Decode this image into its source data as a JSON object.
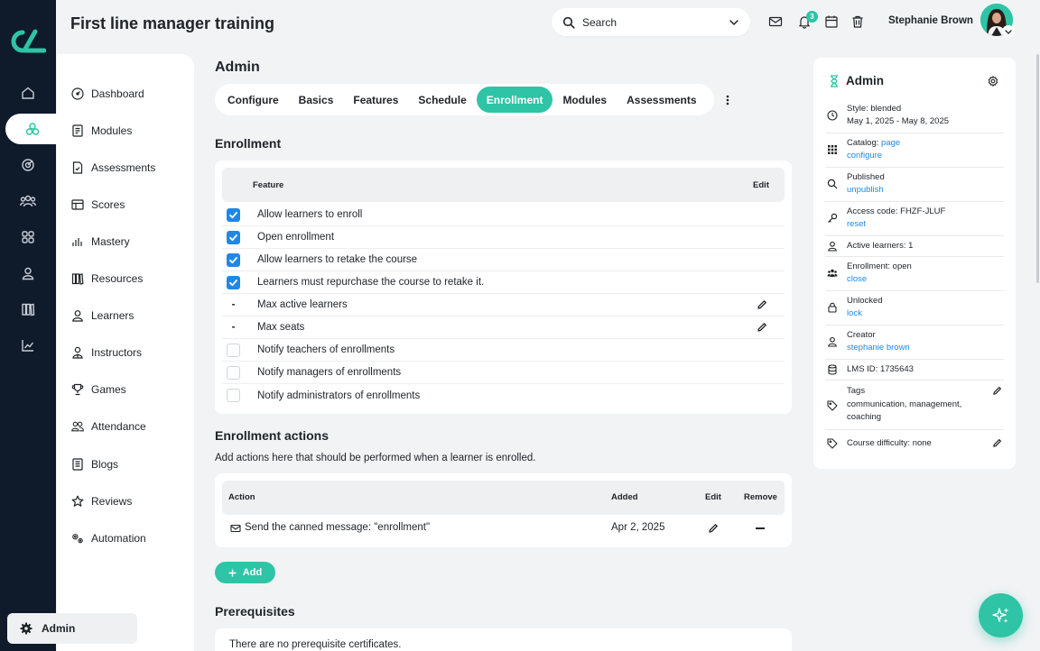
{
  "app": {
    "title": "First line manager training"
  },
  "header": {
    "search_placeholder": "Search",
    "notification_count": "3",
    "user_name": "Stephanie Brown"
  },
  "subnav": {
    "items": [
      {
        "label": "Dashboard",
        "icon": "dashboard-icon"
      },
      {
        "label": "Modules",
        "icon": "modules-icon"
      },
      {
        "label": "Assessments",
        "icon": "assessments-icon"
      },
      {
        "label": "Scores",
        "icon": "scores-icon"
      },
      {
        "label": "Mastery",
        "icon": "mastery-icon"
      },
      {
        "label": "Resources",
        "icon": "resources-icon"
      },
      {
        "label": "Learners",
        "icon": "learners-icon"
      },
      {
        "label": "Instructors",
        "icon": "instructors-icon"
      },
      {
        "label": "Games",
        "icon": "games-icon"
      },
      {
        "label": "Attendance",
        "icon": "attendance-icon"
      },
      {
        "label": "Blogs",
        "icon": "blogs-icon"
      },
      {
        "label": "Reviews",
        "icon": "reviews-icon"
      },
      {
        "label": "Automation",
        "icon": "automation-icon"
      }
    ],
    "admin_label": "Admin"
  },
  "main": {
    "title": "Admin",
    "tabs": [
      {
        "label": "Configure",
        "active": false
      },
      {
        "label": "Basics",
        "active": false
      },
      {
        "label": "Features",
        "active": false
      },
      {
        "label": "Schedule",
        "active": false
      },
      {
        "label": "Enrollment",
        "active": true
      },
      {
        "label": "Modules",
        "active": false
      },
      {
        "label": "Assessments",
        "active": false
      }
    ],
    "enrollment": {
      "title": "Enrollment",
      "col_feature": "Feature",
      "col_edit": "Edit",
      "rows": [
        {
          "label": "Allow learners to enroll",
          "state": "checked",
          "editable": false
        },
        {
          "label": "Open enrollment",
          "state": "checked",
          "editable": false
        },
        {
          "label": "Allow learners to retake the course",
          "state": "checked",
          "editable": false
        },
        {
          "label": "Learners must repurchase the course to retake it.",
          "state": "checked",
          "editable": false
        },
        {
          "label": "Max active learners",
          "state": "dash",
          "editable": true
        },
        {
          "label": "Max seats",
          "state": "dash",
          "editable": true
        },
        {
          "label": "Notify teachers of enrollments",
          "state": "unchecked",
          "editable": false
        },
        {
          "label": "Notify managers of enrollments",
          "state": "unchecked",
          "editable": false
        },
        {
          "label": "Notify administrators of enrollments",
          "state": "unchecked",
          "editable": false
        }
      ],
      "dash_symbol": "-"
    },
    "actions": {
      "title": "Enrollment actions",
      "description": "Add actions here that should be performed when a learner is enrolled.",
      "col_action": "Action",
      "col_added": "Added",
      "col_edit": "Edit",
      "col_remove": "Remove",
      "rows": [
        {
          "action": "Send the canned message: \"enrollment\"",
          "added": "Apr 2, 2025"
        }
      ],
      "add_label": "Add"
    },
    "prerequisites": {
      "title": "Prerequisites",
      "empty_text": "There are no prerequisite certificates."
    }
  },
  "panel": {
    "title": "Admin",
    "style_label": "Style: blended",
    "dates": "May 1, 2025 - May 8, 2025",
    "catalog_label": "Catalog:",
    "catalog_link": "page",
    "catalog_configure": "configure",
    "published_label": "Published",
    "unpublish_link": "unpublish",
    "access_code": "Access code: FHZF-JLUF",
    "reset_link": "reset",
    "active_learners": "Active learners: 1",
    "enrollment_status": "Enrollment: open",
    "close_link": "close",
    "unlocked_label": "Unlocked",
    "lock_link": "lock",
    "creator_label": "Creator",
    "creator_link": "stephanie brown",
    "lms_id": "LMS ID: 1735643",
    "tags_label": "Tags",
    "tags_value1": "communication, management,",
    "tags_value2": "coaching",
    "difficulty": "Course difficulty: none"
  },
  "colors": {
    "accent": "#2ec4a5",
    "link": "#1e88e5",
    "rail": "#0f1a2b",
    "checkbox": "#1e88e5"
  }
}
